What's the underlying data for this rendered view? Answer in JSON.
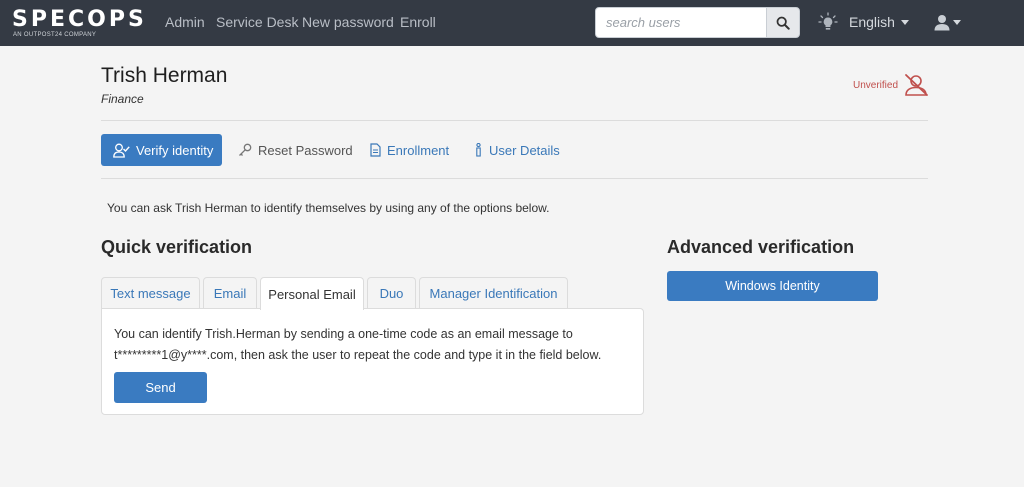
{
  "brand": {
    "name": "SPECOPS",
    "tagline": "AN OUTPOST24 COMPANY"
  },
  "nav": {
    "links": [
      "Admin",
      "Service Desk",
      "New password",
      "Enroll"
    ],
    "search_placeholder": "search users",
    "language": "English"
  },
  "user": {
    "name": "Trish Herman",
    "department": "Finance",
    "status": "Unverified"
  },
  "actions": {
    "verify": "Verify identity",
    "reset": "Reset Password",
    "enrollment": "Enrollment",
    "details": "User Details"
  },
  "intro": "You can ask Trish Herman to identify themselves by using any of the options below.",
  "quick": {
    "title": "Quick verification",
    "tabs": [
      "Text message",
      "Email",
      "Personal Email",
      "Duo",
      "Manager Identification"
    ],
    "active_tab": "Personal Email",
    "panel_line1": "You can identify Trish.Herman by sending a one-time code as an email message to",
    "panel_line2": "t*********1@y****.com, then ask the user to repeat the code and type it in the field below.",
    "send_label": "Send"
  },
  "advanced": {
    "title": "Advanced verification",
    "windows_label": "Windows Identity"
  },
  "colors": {
    "topbar": "#343a44",
    "primary": "#3a7bc1",
    "link": "#3a78b8",
    "warning": "#c0504d"
  },
  "icons": [
    "search-icon",
    "lightbulb-icon",
    "user-icon",
    "user-check-icon",
    "key-icon",
    "document-icon",
    "info-icon",
    "user-slash-icon"
  ]
}
